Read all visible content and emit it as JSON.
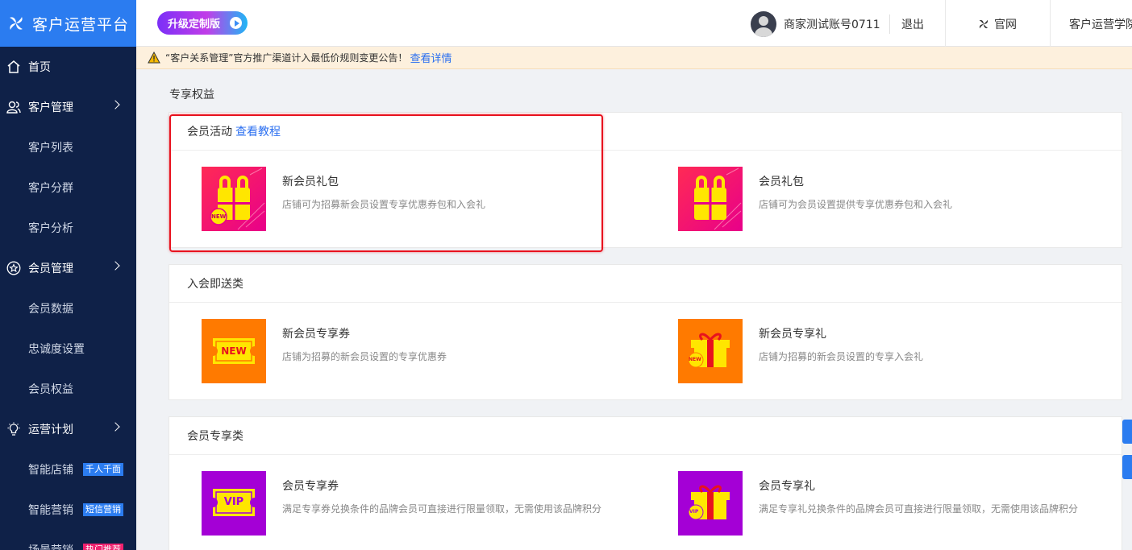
{
  "brand": {
    "title": "客户运营平台"
  },
  "sidebar": {
    "items": [
      {
        "label": "首页",
        "level": "top",
        "icon": "home-icon"
      },
      {
        "label": "客户管理",
        "level": "top",
        "icon": "users-icon",
        "arrow": true
      },
      {
        "label": "客户列表",
        "level": "sub"
      },
      {
        "label": "客户分群",
        "level": "sub"
      },
      {
        "label": "客户分析",
        "level": "sub"
      },
      {
        "label": "会员管理",
        "level": "top",
        "icon": "star-icon",
        "arrow": true
      },
      {
        "label": "会员数据",
        "level": "sub"
      },
      {
        "label": "忠诚度设置",
        "level": "sub"
      },
      {
        "label": "会员权益",
        "level": "sub"
      },
      {
        "label": "运营计划",
        "level": "top",
        "icon": "bulb-icon",
        "arrow": true
      },
      {
        "label": "智能店铺",
        "level": "sub",
        "badge": "千人千面"
      },
      {
        "label": "智能营销",
        "level": "sub",
        "badge": "短信营销"
      },
      {
        "label": "场景营销",
        "level": "sub",
        "badge": "热门推荐",
        "badge_color": "#f0216e"
      }
    ]
  },
  "header": {
    "upgrade_label": "升级定制版",
    "account_name": "商家测试账号0711",
    "logout_label": "退出",
    "official_label": "官网",
    "academy_label": "客户运营学院"
  },
  "notice": {
    "text": "“客户关系管理”官方推广渠道计入最低价规则变更公告！",
    "link": "查看详情"
  },
  "main": {
    "section_title": "专享权益",
    "cards": [
      {
        "title": "会员活动",
        "link": "查看教程",
        "items": [
          {
            "title": "新会员礼包",
            "desc": "店铺可为招募新会员设置专享优惠券包和入会礼",
            "icon": "new-member-gift-pack-icon"
          },
          {
            "title": "会员礼包",
            "desc": "店铺可为会员设置提供专享优惠券包和入会礼",
            "icon": "member-gift-pack-icon"
          }
        ]
      },
      {
        "title": "入会即送类",
        "items": [
          {
            "title": "新会员专享券",
            "desc": "店铺为招募的新会员设置的专享优惠券",
            "icon": "new-coupon-icon"
          },
          {
            "title": "新会员专享礼",
            "desc": "店铺为招募的新会员设置的专享入会礼",
            "icon": "new-gift-icon"
          }
        ]
      },
      {
        "title": "会员专享类",
        "items": [
          {
            "title": "会员专享券",
            "desc": "满足专享券兑换条件的品牌会员可直接进行限量领取，无需使用该品牌积分",
            "icon": "vip-coupon-icon"
          },
          {
            "title": "会员专享礼",
            "desc": "满足专享礼兑换条件的品牌会员可直接进行限量领取，无需使用该品牌积分",
            "icon": "vip-gift-icon"
          }
        ]
      }
    ],
    "thumb_text": {
      "new": "NEW",
      "vip": "VIP"
    }
  },
  "colors": {
    "sidebar_bg": "#0f2148",
    "brand_bg": "#2b7cf0",
    "link": "#2b6ff0",
    "highlight": "#e8121e",
    "pink_thumb": "#f0156f",
    "orange_thumb": "#ff7a00",
    "purple_thumb": "#a400d6",
    "yellow": "#ffe600"
  }
}
